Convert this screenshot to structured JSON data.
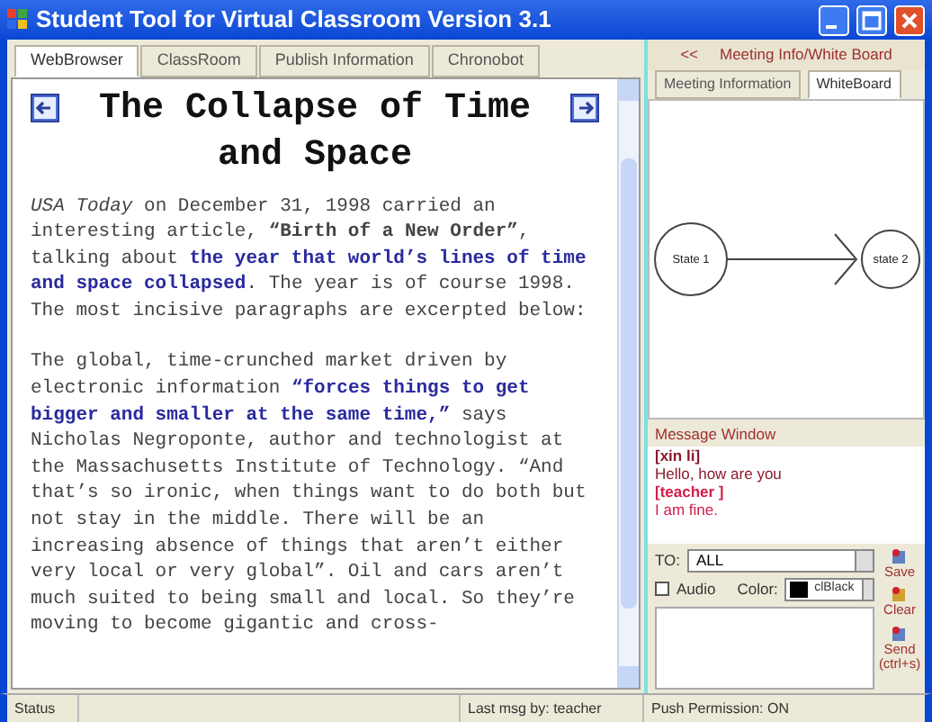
{
  "window": {
    "title": "Student Tool for Virtual Classroom Version 3.1"
  },
  "tabs": [
    {
      "label": "WebBrowser",
      "selected": true
    },
    {
      "label": "ClassRoom",
      "selected": false
    },
    {
      "label": "Publish Information",
      "selected": false
    },
    {
      "label": "Chronobot",
      "selected": false
    }
  ],
  "article": {
    "title": "The Collapse of Time and Space",
    "paragraphs": [
      [
        {
          "kind": "italic",
          "text": "USA Today"
        },
        {
          "kind": "plain",
          "text": " on December 31, 1998 carried an interesting article, "
        },
        {
          "kind": "bold",
          "text": "“Birth of a New Order”"
        },
        {
          "kind": "plain",
          "text": ", talking about "
        },
        {
          "kind": "highlight",
          "text": "the year that world’s lines of time and space collapsed"
        },
        {
          "kind": "plain",
          "text": ". The year is of course 1998. The most incisive paragraphs are excerpted below:"
        }
      ],
      [
        {
          "kind": "plain",
          "text": "The global, time-crunched market driven by electronic information "
        },
        {
          "kind": "highlight",
          "text": "“forces things to get bigger and smaller at the same time,”"
        },
        {
          "kind": "plain",
          "text": " says Nicholas Negroponte, author and technologist at the Massachusetts Institute of Technology. “And that’s so ironic, when things want to do both but not stay in the middle. There will be an increasing absence of things that aren’t either very local or very global”. Oil and cars aren’t much suited to being small and local. So they’re moving to become gigantic and cross-"
        }
      ]
    ]
  },
  "side_panel": {
    "toggle": "<<",
    "title": "Meeting Info/White Board",
    "tabs": [
      {
        "label": "Meeting Information",
        "selected": false
      },
      {
        "label": "WhiteBoard",
        "selected": true
      }
    ],
    "whiteboard": {
      "states": [
        "State 1",
        "state 2"
      ]
    }
  },
  "message_window": {
    "title": "Message Window",
    "messages": [
      {
        "sender": "[xin li]",
        "text": "Hello, how are you",
        "color": "#8b1a2b"
      },
      {
        "sender": "[teacher ]",
        "text": "I am fine.",
        "color": "#d0204a"
      }
    ],
    "to_label": "TO:",
    "to_value": "ALL",
    "audio": {
      "label": "Audio",
      "checked": false
    },
    "color_label": "Color:",
    "color_value": "clBlack",
    "buttons": [
      "Save",
      "Clear",
      "Send (ctrl+s)"
    ]
  },
  "status_bar": {
    "status": "Status",
    "last_message": "Last msg by: teacher",
    "push": "Push Permission: ON"
  }
}
